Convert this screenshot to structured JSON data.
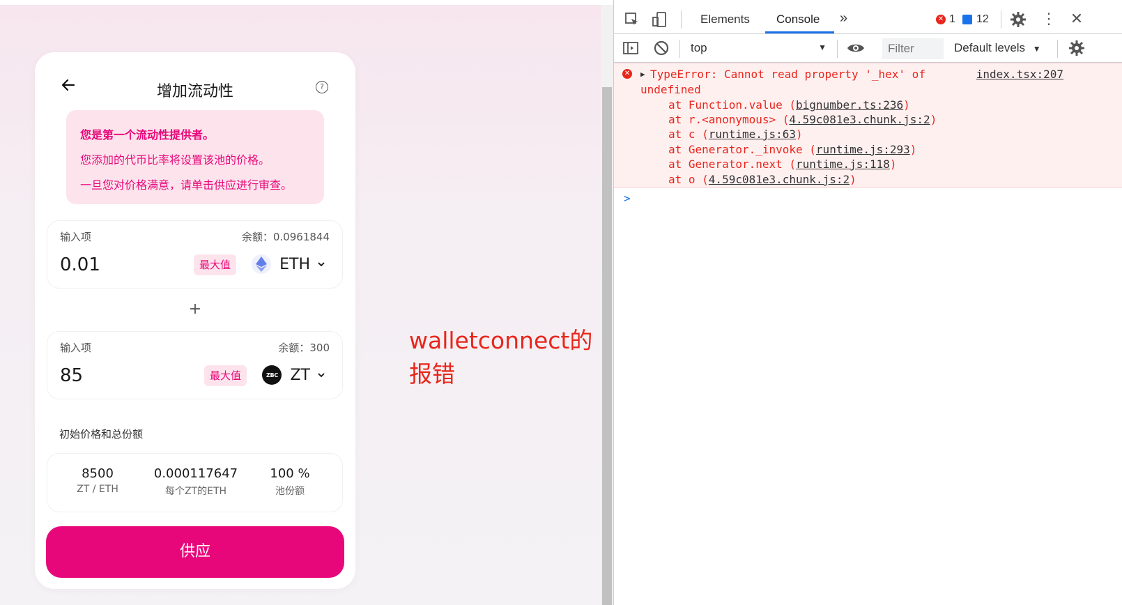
{
  "card": {
    "title": "增加流动性",
    "help_symbol": "?",
    "notice": {
      "title": "您是第一个流动性提供者。",
      "line1": "您添加的代币比率将设置该池的价格。",
      "line2": "一旦您对价格满意，请单击供应进行审查。"
    },
    "input1": {
      "label": "输入项",
      "balance": "余额：0.0961844",
      "amount": "0.01",
      "max_label": "最大值",
      "token": "ETH"
    },
    "plus": "+",
    "input2": {
      "label": "输入项",
      "balance": "余额：300",
      "amount": "85",
      "max_label": "最大值",
      "token": "ZT",
      "token_icon_text": "ZBC"
    },
    "price_section_label": "初始价格和总份额",
    "prices": [
      {
        "value": "8500",
        "sub": "ZT / ETH"
      },
      {
        "value": "0.000117647",
        "sub": "每个ZT的ETH"
      },
      {
        "value": "100 %",
        "sub": "池份额"
      }
    ],
    "supply_label": "供应"
  },
  "annotation": "walletconnect的报错",
  "devtools": {
    "tabs": [
      "Elements",
      "Console"
    ],
    "active_tab": "Console",
    "error_count": "1",
    "message_count": "12",
    "context": "top",
    "filter_placeholder": "Filter",
    "levels": "Default levels",
    "error": {
      "message_line1": "TypeError: Cannot read property '_hex' of",
      "message_line2": "undefined",
      "source": "index.tsx:207",
      "stack": [
        {
          "prefix": "at Function.value (",
          "link": "bignumber.ts:236",
          "suffix": ")"
        },
        {
          "prefix": "at r.<anonymous> (",
          "link": "4.59c081e3.chunk.js:2",
          "suffix": ")"
        },
        {
          "prefix": "at c (",
          "link": "runtime.js:63",
          "suffix": ")"
        },
        {
          "prefix": "at Generator._invoke (",
          "link": "runtime.js:293",
          "suffix": ")"
        },
        {
          "prefix": "at Generator.next (",
          "link": "runtime.js:118",
          "suffix": ")"
        },
        {
          "prefix": "at o (",
          "link": "4.59c081e3.chunk.js:2",
          "suffix": ")"
        }
      ]
    },
    "prompt_symbol": ">"
  },
  "colors": {
    "accent": "#e8077a",
    "notice_bg": "#fde4ec",
    "error_text": "#e8261c",
    "devtools_blue": "#1a73e8"
  }
}
